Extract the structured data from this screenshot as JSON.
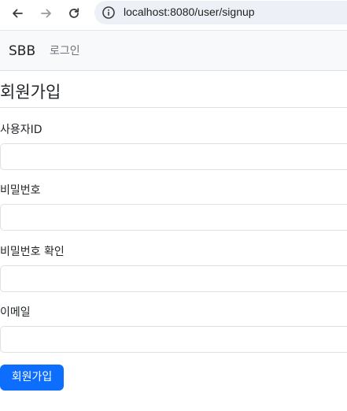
{
  "browser": {
    "url": "localhost:8080/user/signup",
    "icons": {
      "back": "arrow-left-icon",
      "forward": "arrow-right-icon",
      "reload": "reload-icon",
      "site_info": "info-circle-icon"
    }
  },
  "navbar": {
    "brand": "SBB",
    "links": [
      {
        "label": "로그인"
      }
    ]
  },
  "form": {
    "title": "회원가입",
    "fields": [
      {
        "label": "사용자ID",
        "value": ""
      },
      {
        "label": "비밀번호",
        "value": ""
      },
      {
        "label": "비밀번호 확인",
        "value": ""
      },
      {
        "label": "이메일",
        "value": ""
      }
    ],
    "submit_label": "회원가입"
  },
  "colors": {
    "primary": "#0d6efd",
    "navbar_bg": "#f8f9fa",
    "address_bar_bg": "#edf0f6",
    "border": "#dee2e6",
    "muted_text": "#6c757d"
  }
}
